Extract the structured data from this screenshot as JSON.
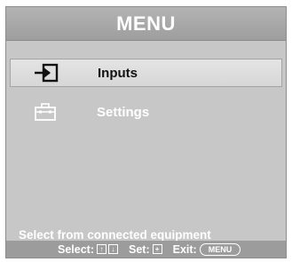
{
  "menu": {
    "title": "MENU",
    "items": [
      {
        "label": "Inputs",
        "icon": "input-arrow-icon",
        "selected": true
      },
      {
        "label": "Settings",
        "icon": "settings-toolbox-icon",
        "selected": false
      }
    ]
  },
  "hint_text": "Select from connected equipment",
  "footer": {
    "select_label": "Select:",
    "set_label": "Set:",
    "exit_label": "Exit:",
    "exit_key_label": "MENU",
    "up_arrow": "↑",
    "down_arrow": "↓",
    "set_key": "+"
  },
  "colors": {
    "panel": "#c7c7c7",
    "titlebar": "#a8a8a8",
    "selected_row": "#dddddd",
    "text_light": "#ffffff",
    "text_dark": "#111111"
  }
}
